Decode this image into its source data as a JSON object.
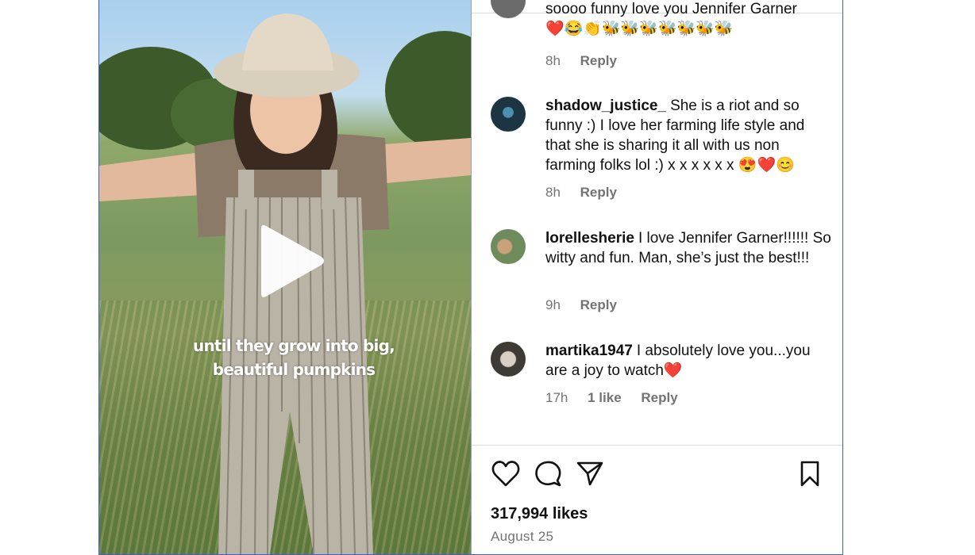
{
  "video": {
    "caption_line1": "until they grow into big,",
    "caption_line2": "beautiful pumpkins",
    "play_icon": "play-icon"
  },
  "comments": [
    {
      "username": "",
      "text": "soooo funny love you Jennifer Garner",
      "emoji": "❤️😂👏🐝🐝🐝🐝🐝🐝🐝",
      "time": "8h",
      "likes": "",
      "reply_label": "Reply"
    },
    {
      "username": "shadow_justice_",
      "text": "She is a riot and so funny :) I love her farming life style and that she is sharing it all with us non farming folks lol :) x x x x x x",
      "emoji": "😍❤️😊",
      "time": "8h",
      "likes": "",
      "reply_label": "Reply"
    },
    {
      "username": "lorellesherie",
      "text": "I love Jennifer Garner!!!!!! So witty and fun. Man, she’s just the best!!!",
      "emoji": "",
      "time": "9h",
      "likes": "",
      "reply_label": "Reply"
    },
    {
      "username": "martika1947",
      "text": "I absolutely love you...you are a joy to watch",
      "emoji": "❤️",
      "time": "17h",
      "likes": "1 like",
      "reply_label": "Reply"
    }
  ],
  "actions": {
    "like_icon": "heart-icon",
    "comment_icon": "comment-icon",
    "share_icon": "send-icon",
    "save_icon": "bookmark-icon"
  },
  "stats": {
    "likes": "317,994 likes",
    "date": "August 25"
  },
  "colors": {
    "border_accent": "#3b63c9",
    "meta_gray": "#737373",
    "divider": "#dbdbdb"
  }
}
